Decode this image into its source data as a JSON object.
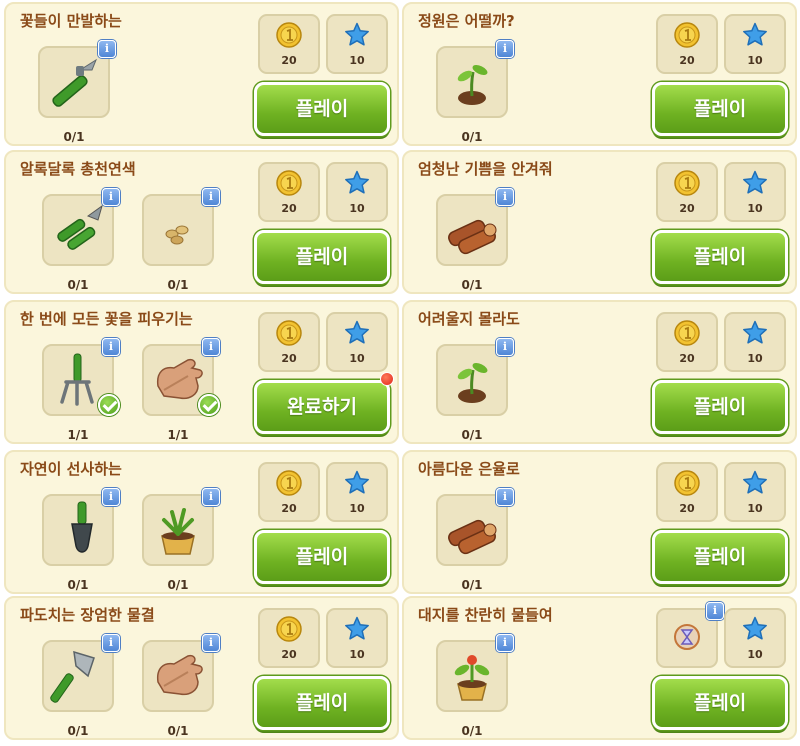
{
  "info_glyph": "i",
  "quests": [
    {
      "title": "꽃들이 만발하는",
      "items": [
        {
          "icon": "pruning-shears-icon",
          "count": "0/1"
        }
      ],
      "rewards": {
        "coins": "20",
        "stars": "10"
      },
      "button": "플레이"
    },
    {
      "title": "정원은 어떨까?",
      "items": [
        {
          "icon": "seedling-icon",
          "count": "0/1"
        }
      ],
      "rewards": {
        "coins": "20",
        "stars": "10"
      },
      "button": "플레이"
    },
    {
      "title": "알록달록 총천연색",
      "items": [
        {
          "icon": "pliers-icon",
          "count": "0/1"
        },
        {
          "icon": "seeds-icon",
          "count": "0/1"
        }
      ],
      "rewards": {
        "coins": "20",
        "stars": "10"
      },
      "button": "플레이"
    },
    {
      "title": "엄청난 기쁨을 안겨줘",
      "items": [
        {
          "icon": "wood-logs-icon",
          "count": "0/1"
        }
      ],
      "rewards": {
        "coins": "20",
        "stars": "10"
      },
      "button": "플레이"
    },
    {
      "title": "한 번에 모든 꽃을 피우기는",
      "items": [
        {
          "icon": "garden-fork-icon",
          "count": "1/1",
          "done": true
        },
        {
          "icon": "gardening-gloves-icon",
          "count": "1/1",
          "done": true
        }
      ],
      "rewards": {
        "coins": "20",
        "stars": "10"
      },
      "button": "완료하기",
      "notify": true
    },
    {
      "title": "어려울지 몰라도",
      "items": [
        {
          "icon": "seedling-icon",
          "count": "0/1"
        }
      ],
      "rewards": {
        "coins": "20",
        "stars": "10"
      },
      "button": "플레이"
    },
    {
      "title": "자연이 선사하는",
      "items": [
        {
          "icon": "trowel-icon",
          "count": "0/1"
        },
        {
          "icon": "potted-plant-icon",
          "count": "0/1"
        }
      ],
      "rewards": {
        "coins": "20",
        "stars": "10"
      },
      "button": "플레이"
    },
    {
      "title": "아름다운 은율로",
      "items": [
        {
          "icon": "wood-logs-icon",
          "count": "0/1"
        }
      ],
      "rewards": {
        "coins": "20",
        "stars": "10"
      },
      "button": "플레이"
    },
    {
      "title": "파도치는 장엄한 물결",
      "items": [
        {
          "icon": "axe-icon",
          "count": "0/1"
        },
        {
          "icon": "gardening-gloves-icon",
          "count": "0/1"
        }
      ],
      "rewards": {
        "coins": "20",
        "stars": "10"
      },
      "button": "플레이"
    },
    {
      "title": "대지를 찬란히 물들여",
      "items": [
        {
          "icon": "flower-pot-icon",
          "count": "0/1"
        }
      ],
      "rewards": {
        "special": "hourglass-booster-icon",
        "stars": "10"
      },
      "button": "플레이"
    }
  ]
}
